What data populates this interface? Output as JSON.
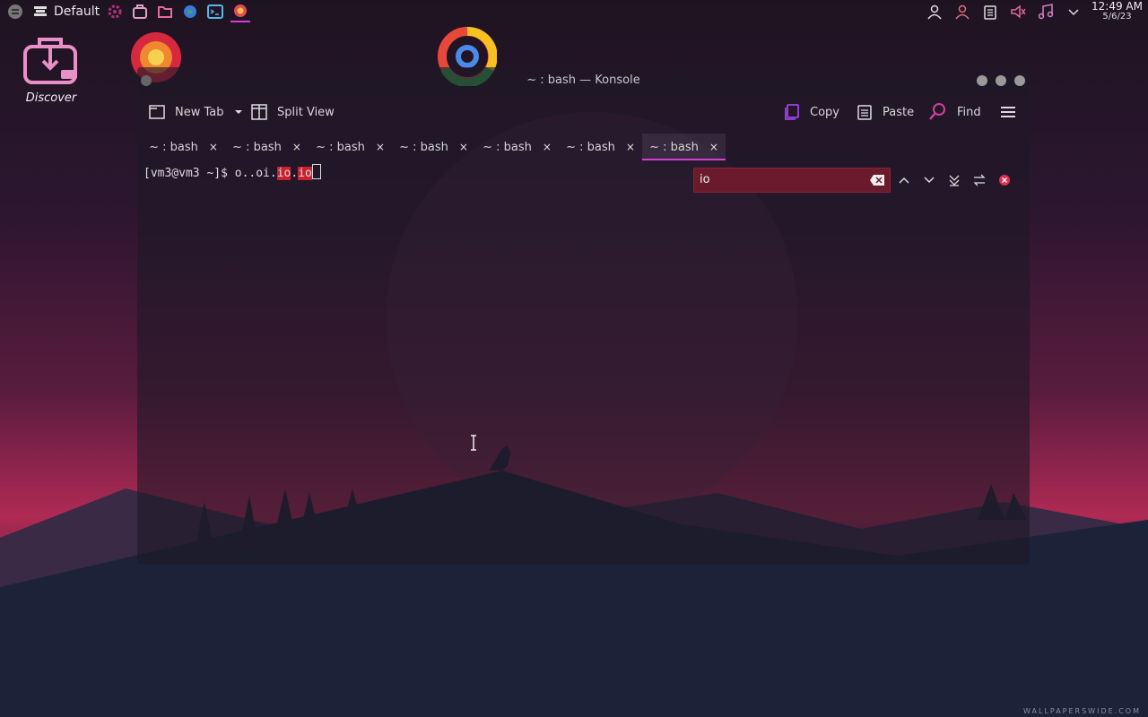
{
  "panel": {
    "layout_label": "Default",
    "icons": [
      "kde-menu-icon",
      "layout-icon",
      "settings-icon",
      "discover-icon",
      "folder-icon",
      "globe-icon",
      "terminal-icon",
      "firefox-icon"
    ],
    "tray_icons": [
      "user-icon",
      "user-alt-icon",
      "clipboard-icon",
      "volume-icon",
      "music-icon",
      "chevron-down-icon"
    ],
    "clock_time": "12:49 AM",
    "clock_date": "5/6/23"
  },
  "desktop": {
    "discover_label": "Discover"
  },
  "window": {
    "title": "~ : bash — Konsole",
    "toolbar": {
      "new_tab": "New Tab",
      "split_view": "Split View",
      "copy": "Copy",
      "paste": "Paste",
      "find": "Find"
    },
    "tabs": [
      {
        "label": "~ : bash",
        "active": false
      },
      {
        "label": "~ : bash",
        "active": false
      },
      {
        "label": "~ : bash",
        "active": false
      },
      {
        "label": "~ : bash",
        "active": false
      },
      {
        "label": "~ : bash",
        "active": false
      },
      {
        "label": "~ : bash",
        "active": false
      },
      {
        "label": "~ : bash",
        "active": true
      }
    ],
    "terminal": {
      "prompt": "[vm3@vm3 ~]$ ",
      "text_plain": "o..oi.",
      "match1": "io",
      "sep": ".",
      "match2": "io"
    },
    "search": {
      "value": "io"
    }
  },
  "watermark": "WALLPAPERSWIDE.COM",
  "colors": {
    "accent": "#d83cd6",
    "highlight": "#c8222e",
    "search_bg": "#6a1a2a"
  }
}
